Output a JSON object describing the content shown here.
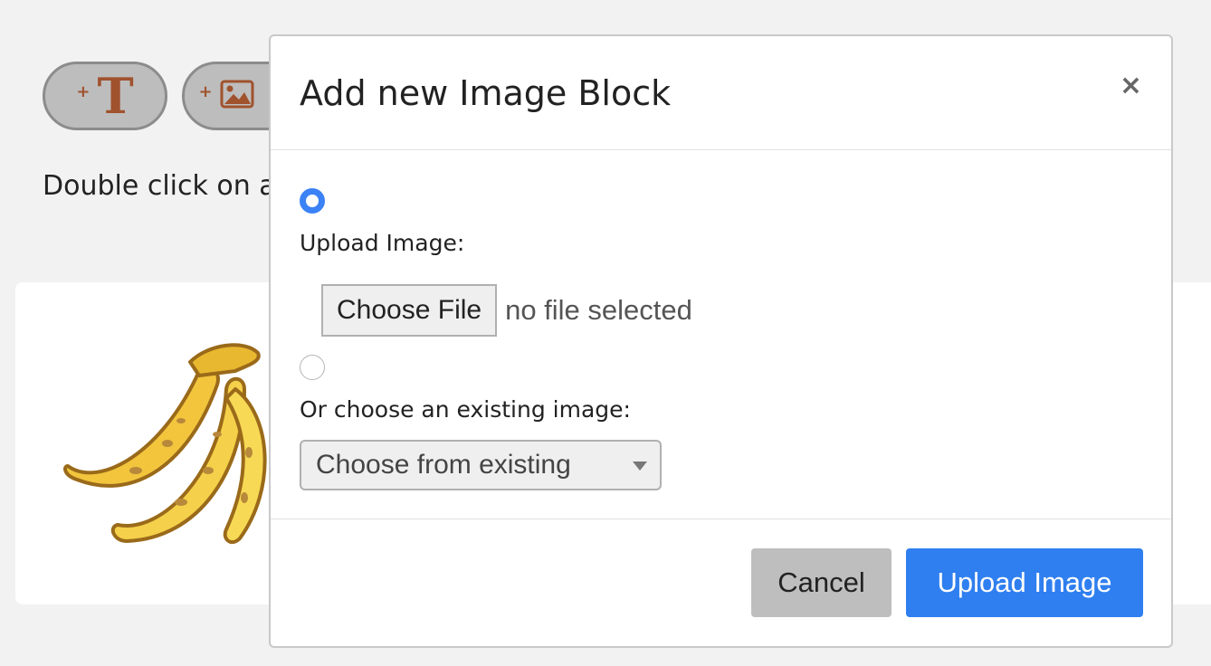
{
  "toolbar": {
    "add_text_plus": "+",
    "add_text_glyph": "T",
    "add_image_plus": "+",
    "add_image_icon": "image-icon"
  },
  "hint_text": "Double click on a",
  "canvas": {
    "image_icon": "banana-image"
  },
  "modal": {
    "title": "Add new Image Block",
    "close_label": "×",
    "upload": {
      "selected": true,
      "label": "Upload Image:",
      "choose_file_label": "Choose File",
      "file_status": "no file selected"
    },
    "existing": {
      "selected": false,
      "label": "Or choose an existing image:",
      "select_value": "Choose from existing"
    },
    "footer": {
      "cancel_label": "Cancel",
      "upload_label": "Upload Image"
    }
  },
  "colors": {
    "accent": "#2f7ff0",
    "radio_selected": "#3b82f6",
    "toolbar_glyph": "#a0522d"
  }
}
